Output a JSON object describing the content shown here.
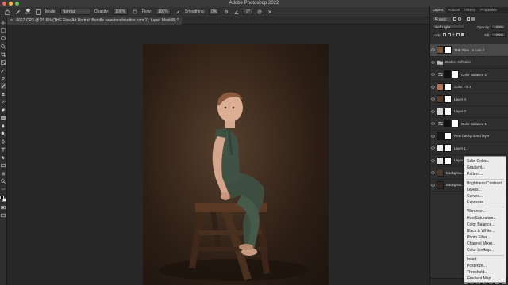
{
  "window": {
    "title": "Adobe Photoshop 2022",
    "traffic_colors": [
      "#ed6a5e",
      "#f5bf4f",
      "#61c554"
    ]
  },
  "options_bar": {
    "brush_size": "270",
    "mode_label": "Mode:",
    "mode_value": "Normal",
    "opacity_label": "Opacity:",
    "opacity_value": "100%",
    "flow_label": "Flow:",
    "flow_value": "100%",
    "smoothing_label": "Smoothing:",
    "smoothing_value": "0%",
    "angle_value": "0°"
  },
  "document": {
    "tab_label": "6667.CR3 @ 25.6% (THE Fine Art Portrait Bundle sweetsoulstudios.com 1), Layer Mask/8) *",
    "tab_close": "×"
  },
  "layers_panel": {
    "tabs": [
      "Layers",
      "Actions",
      "History",
      "Properties"
    ],
    "active_tab": "Layers",
    "filter_value": "Kind",
    "blend_mode": "Soft Light",
    "opacity_label": "Opacity:",
    "opacity_value": "100%",
    "lock_label": "Lock:",
    "fill_label": "Fill:",
    "fill_value": "100%",
    "layers": [
      {
        "name": "THE Fine...s.com 1",
        "kind": "image",
        "thumb": "#7a5236",
        "selected": true
      },
      {
        "name": "Perfect soft skin",
        "kind": "group",
        "thumb": "#3a3a3a",
        "selected": false
      },
      {
        "name": "Color Balance 2",
        "kind": "adjust",
        "thumb": "#111111",
        "selected": false
      },
      {
        "name": "Color Fill 1",
        "kind": "fill",
        "thumb": "#b57153",
        "selected": false
      },
      {
        "name": "Layer 4",
        "kind": "image",
        "thumb": "#5b3e2b",
        "selected": false
      },
      {
        "name": "Layer 3",
        "kind": "image",
        "thumb": "#d5d5d5",
        "selected": false
      },
      {
        "name": "Color Balance 1",
        "kind": "adjust",
        "thumb": "#111111",
        "selected": false
      },
      {
        "name": "New background layer",
        "kind": "image",
        "thumb": "#1a1a1a",
        "selected": false
      },
      {
        "name": "Layer 1",
        "kind": "image",
        "thumb": "#ececec",
        "selected": false
      },
      {
        "name": "Layer 2",
        "kind": "image",
        "thumb": "#e1e1e1",
        "selected": false
      },
      {
        "name": "Backgrou...",
        "kind": "image",
        "thumb": "#4b3a2c",
        "selected": false
      },
      {
        "name": "Backgrou...",
        "kind": "image",
        "thumb": "#34281f",
        "selected": false
      }
    ]
  },
  "adjustment_menu": {
    "groups": [
      [
        "Solid Color...",
        "Gradient...",
        "Pattern..."
      ],
      [
        "Brightness/Contrast...",
        "Levels...",
        "Curves...",
        "Exposure..."
      ],
      [
        "Vibrance...",
        "Hue/Saturation...",
        "Color Balance...",
        "Black & White...",
        "Photo Filter...",
        "Channel Mixer...",
        "Color Lookup..."
      ],
      [
        "Invert",
        "Posterize...",
        "Threshold...",
        "Gradient Map...",
        "Selective Color..."
      ]
    ]
  }
}
